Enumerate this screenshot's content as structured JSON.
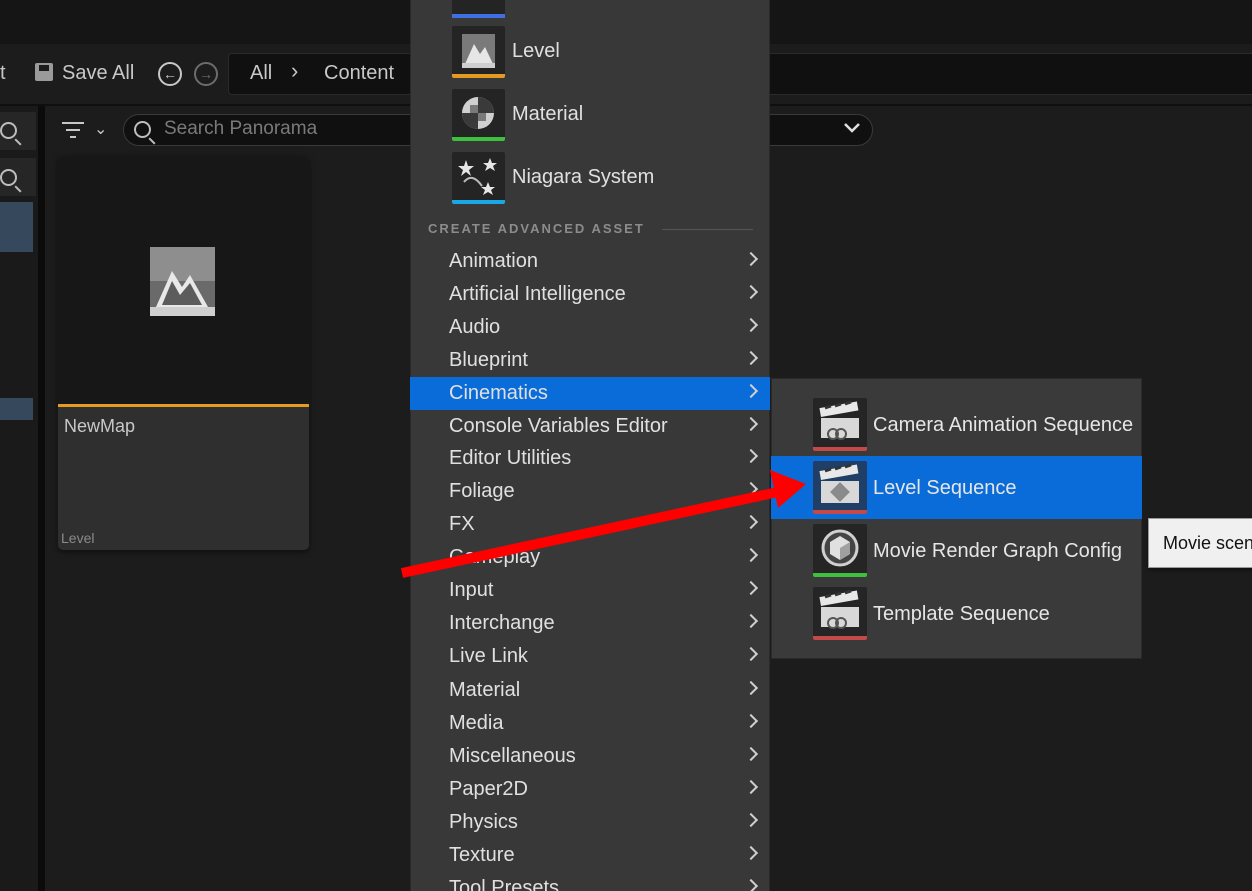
{
  "toolbar": {
    "partial_label": "t",
    "save_all": "Save All",
    "breadcrumb": [
      "All",
      "Content"
    ]
  },
  "search": {
    "placeholder": "Search Panorama"
  },
  "tile": {
    "name": "NewMap",
    "type": "Level"
  },
  "menu": {
    "basic_assets": [
      {
        "label": "Level",
        "icon": "level-icon",
        "strip": "#e59a23"
      },
      {
        "label": "Material",
        "icon": "material-icon",
        "strip": "#3fbf3f"
      },
      {
        "label": "Niagara System",
        "icon": "niagara-icon",
        "strip": "#1aa7e6"
      }
    ],
    "section_header": "CREATE ADVANCED ASSET",
    "categories": [
      "Animation",
      "Artificial Intelligence",
      "Audio",
      "Blueprint",
      "Cinematics",
      "Console Variables Editor",
      "Editor Utilities",
      "Foliage",
      "FX",
      "Gameplay",
      "Input",
      "Interchange",
      "Live Link",
      "Material",
      "Media",
      "Miscellaneous",
      "Paper2D",
      "Physics",
      "Texture",
      "Tool Presets"
    ],
    "selected_category": "Cinematics"
  },
  "submenu": {
    "items": [
      {
        "label": "Camera Animation Sequence",
        "icon": "clapperboard-icon",
        "strip": "#c44a4a"
      },
      {
        "label": "Level Sequence",
        "icon": "level-sequence-icon",
        "strip": "#c44a4a"
      },
      {
        "label": "Movie Render Graph Config",
        "icon": "render-graph-icon",
        "strip": "#3fbf3f"
      },
      {
        "label": "Template Sequence",
        "icon": "clapperboard-icon",
        "strip": "#c44a4a"
      }
    ],
    "selected": "Level Sequence"
  },
  "tooltip": {
    "text": "Movie scen"
  },
  "colors": {
    "accent": "#0a6cd9",
    "annotation_arrow": "#ff0000"
  }
}
